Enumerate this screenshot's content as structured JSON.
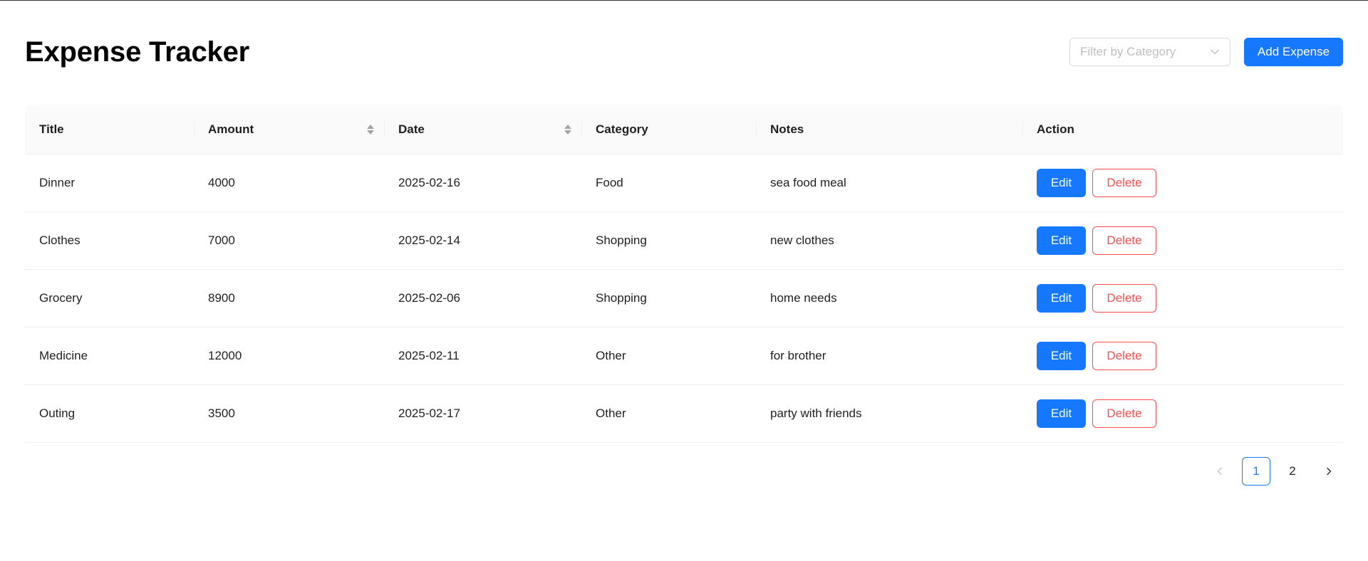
{
  "header": {
    "title": "Expense Tracker",
    "filter_placeholder": "Filter by Category",
    "add_button_label": "Add Expense"
  },
  "table": {
    "columns": [
      {
        "label": "Title",
        "sortable": false
      },
      {
        "label": "Amount",
        "sortable": true
      },
      {
        "label": "Date",
        "sortable": true
      },
      {
        "label": "Category",
        "sortable": false
      },
      {
        "label": "Notes",
        "sortable": false
      },
      {
        "label": "Action",
        "sortable": false
      }
    ],
    "rows": [
      {
        "title": "Dinner",
        "amount": "4000",
        "date": "2025-02-16",
        "category": "Food",
        "notes": "sea food meal"
      },
      {
        "title": "Clothes",
        "amount": "7000",
        "date": "2025-02-14",
        "category": "Shopping",
        "notes": "new clothes"
      },
      {
        "title": "Grocery",
        "amount": "8900",
        "date": "2025-02-06",
        "category": "Shopping",
        "notes": "home needs"
      },
      {
        "title": "Medicine",
        "amount": "12000",
        "date": "2025-02-11",
        "category": "Other",
        "notes": "for brother"
      },
      {
        "title": "Outing",
        "amount": "3500",
        "date": "2025-02-17",
        "category": "Other",
        "notes": "party with friends"
      }
    ],
    "edit_label": "Edit",
    "delete_label": "Delete"
  },
  "pagination": {
    "pages": [
      "1",
      "2"
    ],
    "current": "1",
    "prev_icon": "chevron-left-icon",
    "next_icon": "chevron-right-icon"
  },
  "colors": {
    "primary": "#1677ff",
    "danger": "#ff4d4f"
  }
}
